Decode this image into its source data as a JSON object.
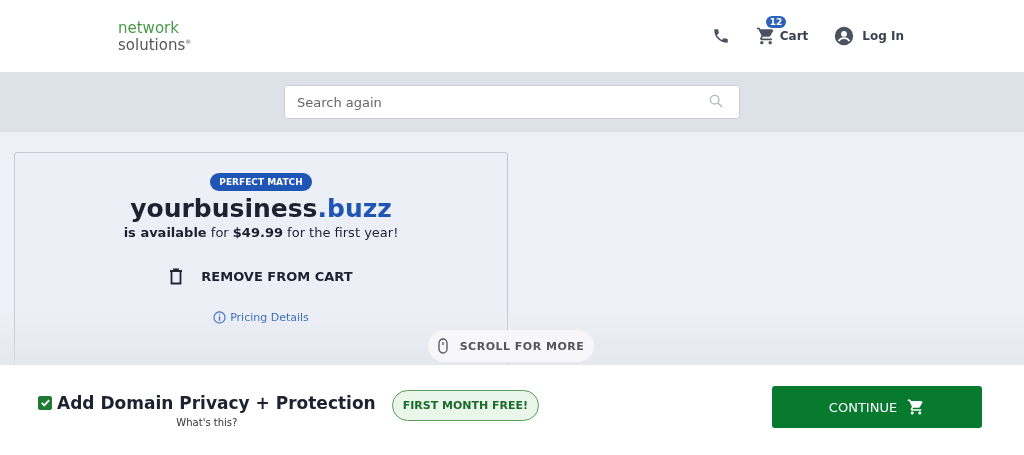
{
  "header": {
    "logo": {
      "line_1": "network",
      "line_2": "solutions$^{®}$"
    },
    "cart": {
      "label": "Cart",
      "count": "12"
    },
    "login": "Log In"
  },
  "search": {
    "placeholder": "Search again"
  },
  "result": {
    "badge": "PERFECT MATCH",
    "domain_name": "yourbusiness",
    "domain_tld": ".buzz",
    "availability": "**is available** for **$49.99** for the first year!",
    "remove_button": "REMOVE FROM CART",
    "pricing_link": "Pricing Details"
  },
  "scroll_hint": "SCROLL FOR MORE",
  "footer": {
    "privacy": {
      "label": "Add Domain Privacy + Protection",
      "checked": true,
      "help_link": "What's this?"
    },
    "promo_badge": "FIRST MONTH FREE!",
    "continue_button": "CONTINUE"
  }
}
